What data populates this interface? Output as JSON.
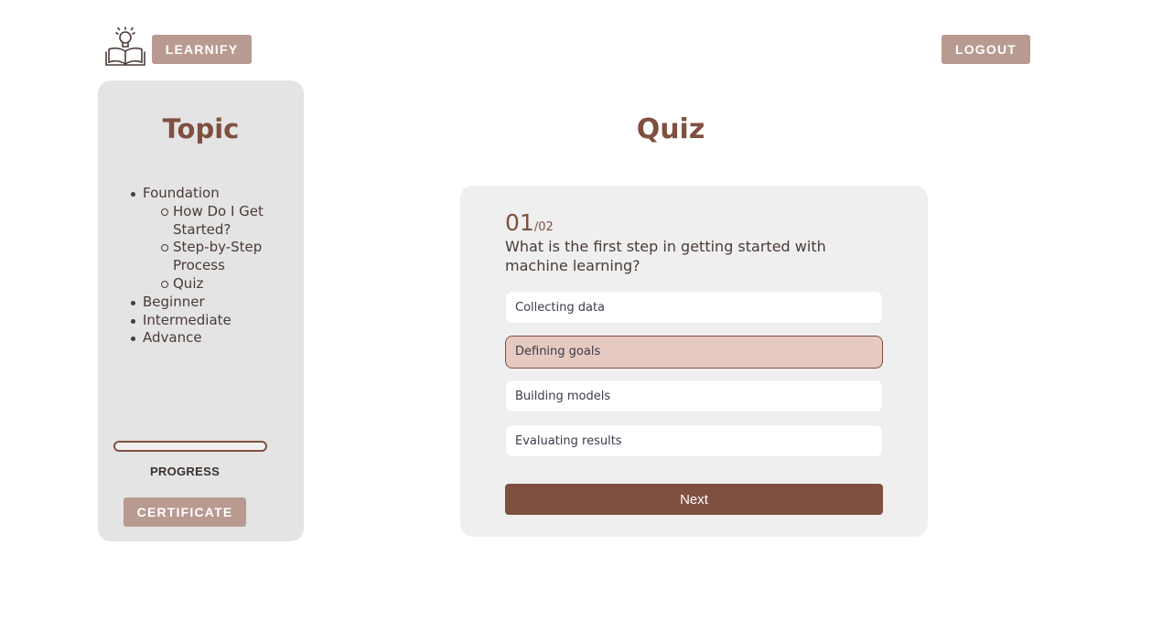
{
  "header": {
    "brand_label": "LEARNIFY",
    "logout_label": "LOGOUT",
    "logo_icon": "book-lightbulb-icon"
  },
  "sidebar": {
    "title": "Topic",
    "topics": [
      {
        "label": "Foundation",
        "children": [
          {
            "label": "How Do I Get Started?"
          },
          {
            "label": "Step-by-Step Process"
          },
          {
            "label": "Quiz"
          }
        ]
      },
      {
        "label": "Beginner"
      },
      {
        "label": "Intermediate"
      },
      {
        "label": "Advance"
      }
    ],
    "progress_label": "PROGRESS",
    "progress_value": 0,
    "certificate_label": "CERTIFICATE"
  },
  "quiz": {
    "title": "Quiz",
    "question_number": "01",
    "question_total": "/02",
    "question_text": "What is the first step in getting started with machine learning?",
    "options": [
      {
        "label": "Collecting data",
        "selected": false
      },
      {
        "label": "Defining goals",
        "selected": true
      },
      {
        "label": "Building models",
        "selected": false
      },
      {
        "label": "Evaluating results",
        "selected": false
      }
    ],
    "next_label": "Next"
  },
  "colors": {
    "accent": "#7f5040",
    "button_muted": "#b89a91",
    "selected_option": "#e6c9c0",
    "panel": "#e4e4e4"
  }
}
